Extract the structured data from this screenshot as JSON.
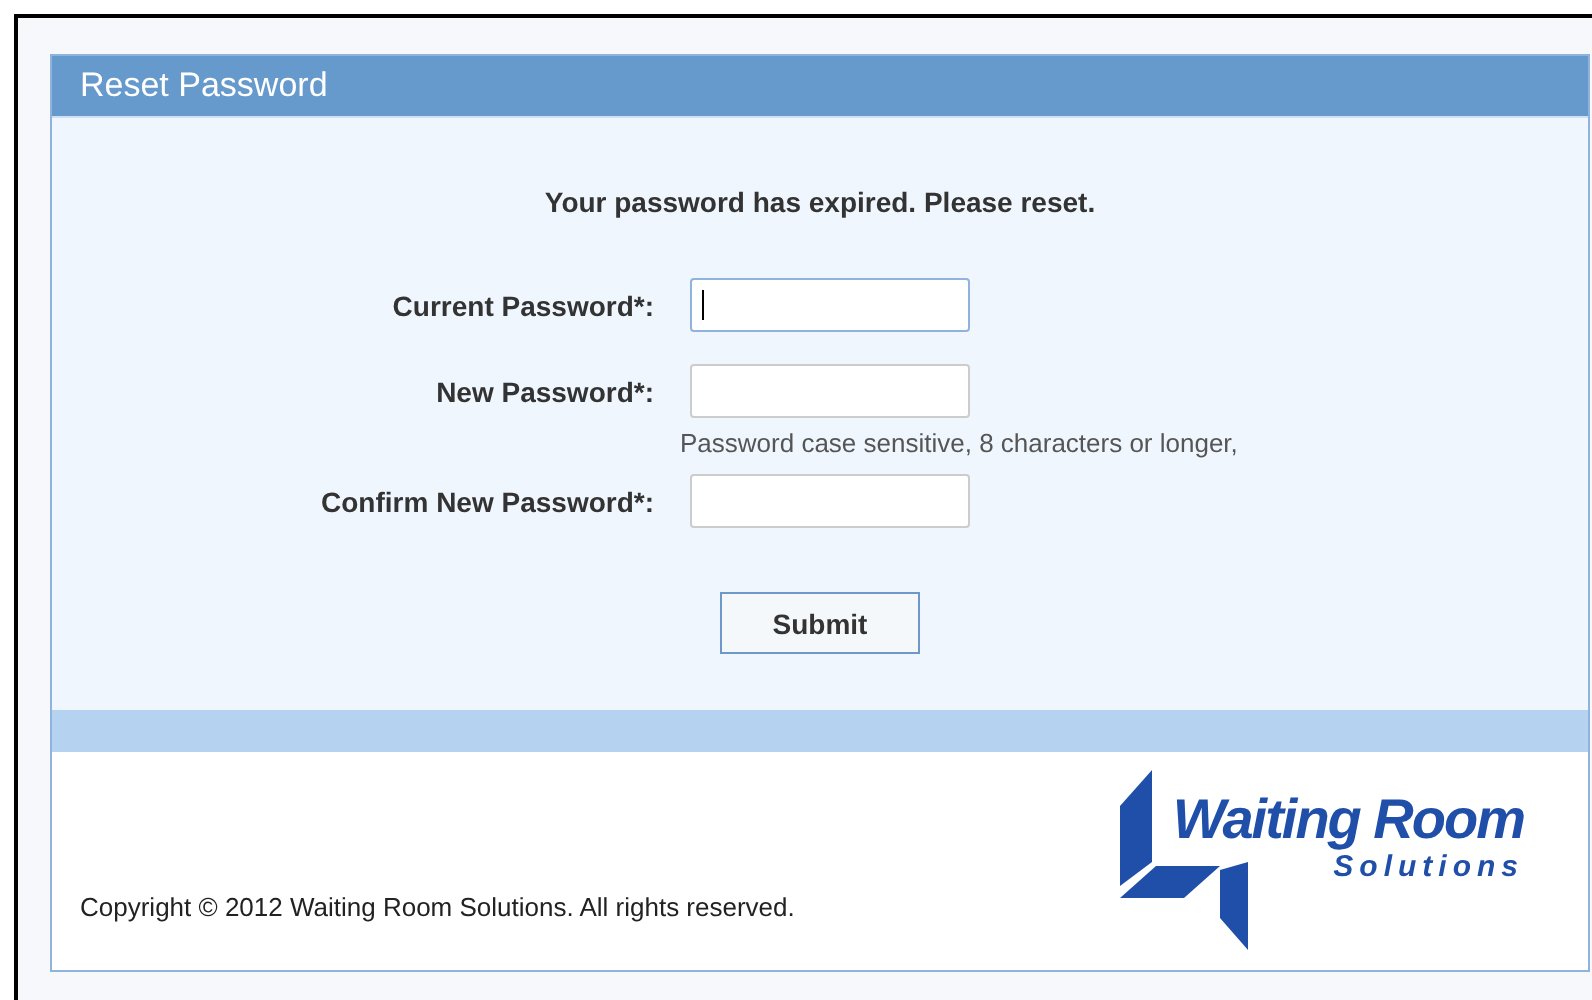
{
  "panel": {
    "title": "Reset Password"
  },
  "message": "Your password has expired. Please reset.",
  "fields": [
    {
      "label": "Current Password*:",
      "focused": true
    },
    {
      "label": "New Password*:",
      "focused": false,
      "hint": "Password case sensitive, 8 characters or longer,"
    },
    {
      "label": "Confirm New Password*:",
      "focused": false
    }
  ],
  "submit_button": "Submit",
  "footer": {
    "copyright": "Copyright © 2012 Waiting Room Solutions. All rights reserved.",
    "logo_title": "Waiting Room",
    "logo_subtitle": "Solutions"
  }
}
